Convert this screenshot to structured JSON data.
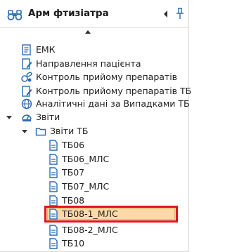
{
  "header": {
    "title": "Арм фтизіатра",
    "icon": "binoculars-icon",
    "collapse_button": "triangle-left-icon",
    "pin_button": "pin-icon"
  },
  "tree": {
    "items": [
      {
        "label": "ЕМК",
        "icon": "document-list-icon"
      },
      {
        "label": "Направлення пацієнта",
        "icon": "document-edit-icon"
      },
      {
        "label": "Контроль прийому препаратів",
        "icon": "pills-icon"
      },
      {
        "label": "Контроль прийому препаратів ТБ",
        "icon": "document-edit-icon"
      },
      {
        "label": "Аналітичні дані за Випадками ТБ",
        "icon": "globe-icon"
      },
      {
        "label": "Звіти",
        "icon": "dashboard-icon",
        "expanded": true
      },
      {
        "label": "Звіти ТБ",
        "icon": "folder-icon",
        "expanded": true
      },
      {
        "label": "ТБ06",
        "icon": "report-icon"
      },
      {
        "label": "ТБ06_МЛС",
        "icon": "report-icon"
      },
      {
        "label": "ТБ07",
        "icon": "report-icon"
      },
      {
        "label": "ТБ07_МЛС",
        "icon": "report-icon"
      },
      {
        "label": "ТБ08",
        "icon": "report-icon"
      },
      {
        "label": "ТБ08-1_МЛС",
        "icon": "report-icon",
        "selected": true
      },
      {
        "label": "ТБ08-2_МЛС",
        "icon": "report-icon"
      },
      {
        "label": "ТБ10",
        "icon": "report-icon"
      }
    ]
  },
  "colors": {
    "selection_fill": "#fdd9a9",
    "selection_highlight_border": "#e0161b",
    "icon_blue": "#2b6cb8"
  }
}
